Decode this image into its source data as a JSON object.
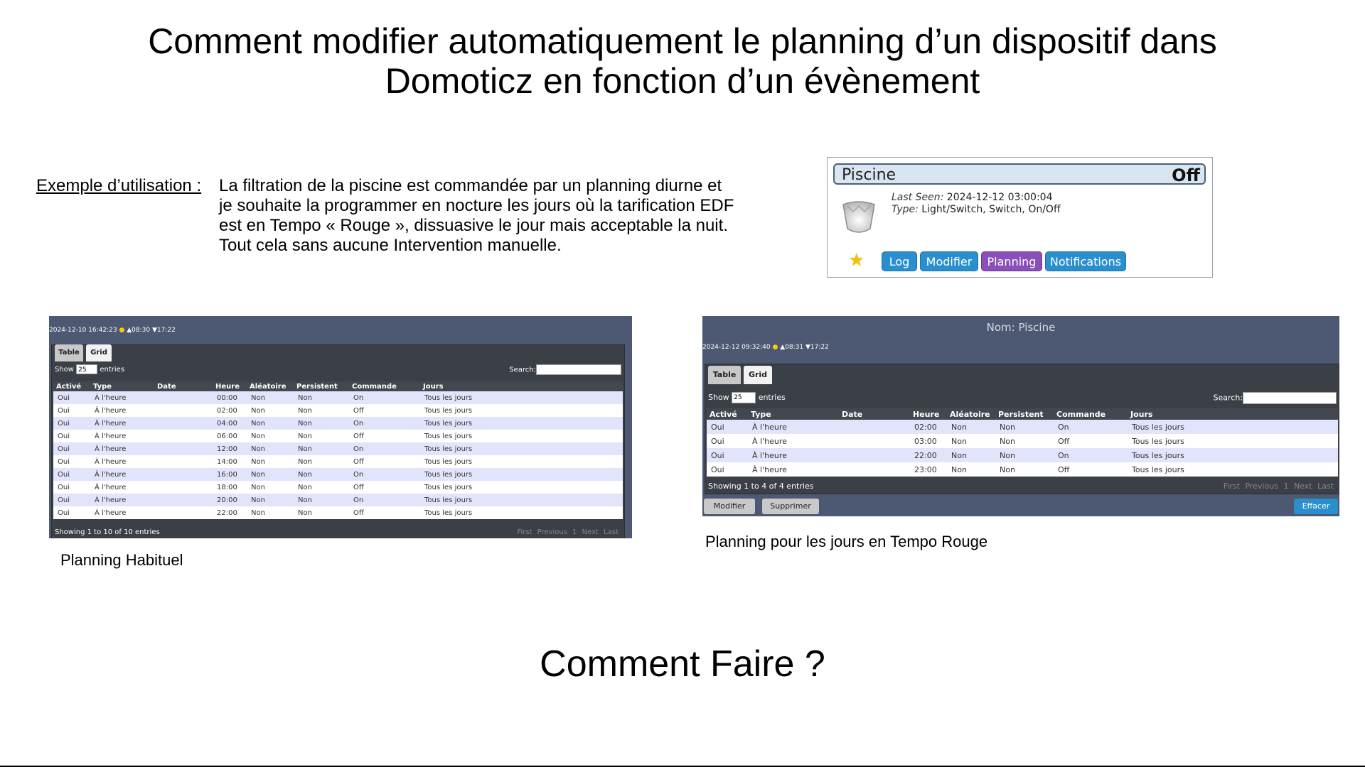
{
  "title": {
    "line1": "Comment  modifier automatiquement le planning d’un dispositif dans",
    "line2": "Domoticz en fonction d’un évènement"
  },
  "example": {
    "label": "Exemple d’utilisation :",
    "lines": [
      "La filtration de la piscine est commandée par un planning diurne et",
      "je souhaite  la programmer en nocture les jours où la tarification EDF",
      "est en Tempo « Rouge », dissuasive le jour mais acceptable la nuit.",
      "Tout cela sans aucune Intervention manuelle."
    ]
  },
  "device": {
    "name": "Piscine",
    "state": "Off",
    "last_seen_label": "Last Seen:",
    "last_seen": "2024-12-12 03:00:04",
    "type_label": "Type:",
    "type": "Light/Switch, Switch, On/Off",
    "buttons": {
      "log": "Log",
      "modifier": "Modifier",
      "planning": "Planning",
      "notifications": "Notifications"
    },
    "icons": {
      "favorite": "star-icon",
      "device": "switch-bulb-icon"
    }
  },
  "common": {
    "tab_table": "Table",
    "tab_grid": "Grid",
    "show": "Show",
    "show_value": "25",
    "entries": "entries",
    "search": "Search:",
    "columns": [
      "Activé",
      "Type",
      "Date",
      "Heure",
      "Aléatoire",
      "Persistent",
      "Commande",
      "Jours"
    ],
    "pager": {
      "first": "First",
      "previous": "Previous",
      "page": "1",
      "next": "Next",
      "last": "Last"
    }
  },
  "panel1": {
    "time": "2024-12-10 16:42:23",
    "sunrise": "▲08:30",
    "sunset": "▼17:22",
    "rows": [
      [
        "Oui",
        "À l'heure",
        "",
        "00:00",
        "Non",
        "Non",
        "On",
        "Tous les jours"
      ],
      [
        "Oui",
        "À l'heure",
        "",
        "02:00",
        "Non",
        "Non",
        "Off",
        "Tous les jours"
      ],
      [
        "Oui",
        "À l'heure",
        "",
        "04:00",
        "Non",
        "Non",
        "On",
        "Tous les jours"
      ],
      [
        "Oui",
        "À l'heure",
        "",
        "06:00",
        "Non",
        "Non",
        "Off",
        "Tous les jours"
      ],
      [
        "Oui",
        "À l'heure",
        "",
        "12:00",
        "Non",
        "Non",
        "On",
        "Tous les jours"
      ],
      [
        "Oui",
        "À l'heure",
        "",
        "14:00",
        "Non",
        "Non",
        "Off",
        "Tous les jours"
      ],
      [
        "Oui",
        "À l'heure",
        "",
        "16:00",
        "Non",
        "Non",
        "On",
        "Tous les jours"
      ],
      [
        "Oui",
        "À l'heure",
        "",
        "18:00",
        "Non",
        "Non",
        "Off",
        "Tous les jours"
      ],
      [
        "Oui",
        "À l'heure",
        "",
        "20:00",
        "Non",
        "Non",
        "On",
        "Tous les jours"
      ],
      [
        "Oui",
        "À l'heure",
        "",
        "22:00",
        "Non",
        "Non",
        "Off",
        "Tous les jours"
      ]
    ],
    "footer": "Showing 1 to 10 of 10 entries",
    "caption": "Planning Habituel"
  },
  "panel2": {
    "heading": "Nom: Piscine",
    "time": "2024-12-12 09:32:40",
    "sunrise": "▲08:31",
    "sunset": "▼17:22",
    "rows": [
      [
        "Oui",
        "À l'heure",
        "",
        "02:00",
        "Non",
        "Non",
        "On",
        "Tous les jours"
      ],
      [
        "Oui",
        "À l'heure",
        "",
        "03:00",
        "Non",
        "Non",
        "Off",
        "Tous les jours"
      ],
      [
        "Oui",
        "À l'heure",
        "",
        "22:00",
        "Non",
        "Non",
        "On",
        "Tous les jours"
      ],
      [
        "Oui",
        "À l'heure",
        "",
        "23:00",
        "Non",
        "Non",
        "Off",
        "Tous les jours"
      ]
    ],
    "footer": "Showing 1 to 4 of 4 entries",
    "buttons": {
      "modifier": "Modifier",
      "supprimer": "Supprimer",
      "effacer": "Effacer"
    },
    "caption": "Planning pour les jours en Tempo Rouge"
  },
  "bottom": "Comment  Faire ?"
}
